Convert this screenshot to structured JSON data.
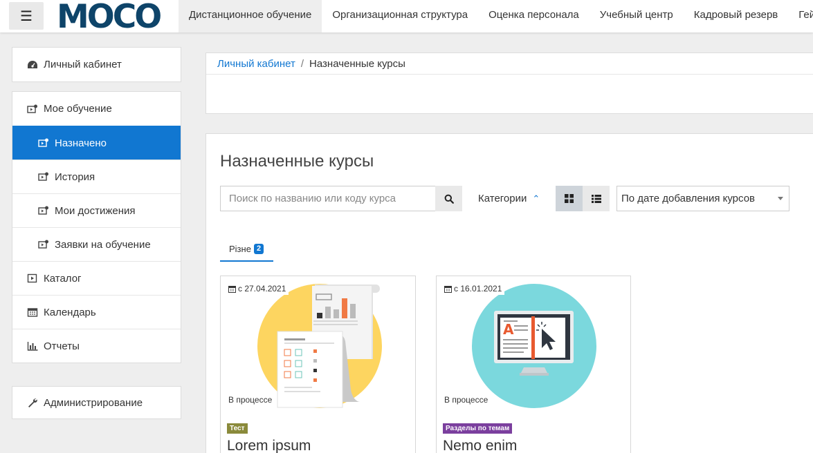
{
  "header": {
    "menu_icon": "hamburger-icon",
    "logo_text": "MOCO",
    "nav": [
      {
        "label": "Дистанционное обучение",
        "active": true
      },
      {
        "label": "Организационная структура"
      },
      {
        "label": "Оценка персонала"
      },
      {
        "label": "Учебный центр"
      },
      {
        "label": "Кадровый резерв"
      },
      {
        "label": "Гей"
      }
    ]
  },
  "sidebar": {
    "cabinet": {
      "label": "Личный кабинет",
      "icon": "dashboard-icon"
    },
    "my_learning": {
      "label": "Мое обучение",
      "icon": "course-icon"
    },
    "sub_items": [
      {
        "label": "Назначено",
        "icon": "course-icon",
        "active": true
      },
      {
        "label": "История",
        "icon": "course-icon"
      },
      {
        "label": "Мои достижения",
        "icon": "course-icon"
      },
      {
        "label": "Заявки на обучение",
        "icon": "course-icon"
      }
    ],
    "bottom_items": [
      {
        "label": "Каталог",
        "icon": "play-square-icon"
      },
      {
        "label": "Календарь",
        "icon": "calendar-icon"
      },
      {
        "label": "Отчеты",
        "icon": "bar-chart-icon"
      }
    ],
    "admin": {
      "label": "Администрирование",
      "icon": "wrench-icon"
    }
  },
  "breadcrumb": {
    "home": "Личный кабинет",
    "separator": "/",
    "current": "Назначенные курсы"
  },
  "main": {
    "title": "Назначенные курсы",
    "search": {
      "placeholder": "Поиск по названию или коду курса",
      "value": ""
    },
    "categories_label": "Категории",
    "sort": {
      "selected": "По дате добавления курсов"
    },
    "tab": {
      "label": "Різне",
      "count": "2"
    }
  },
  "colors": {
    "accent": "#1177d1",
    "tag_test": "#8a8a3b",
    "tag_sections": "#7b3f9e",
    "card1_circle": "#fdd560",
    "card2_circle": "#7bd8dd"
  },
  "courses": [
    {
      "date": "с 27.04.2021",
      "status": "В процессе",
      "tag": "Тест",
      "title": "Lorem ipsum",
      "image": "documents-chart-illustration"
    },
    {
      "date": "с 16.01.2021",
      "status": "В процессе",
      "tag": "Разделы по темам",
      "title": "Nemo enim",
      "image": "monitor-book-illustration"
    }
  ]
}
